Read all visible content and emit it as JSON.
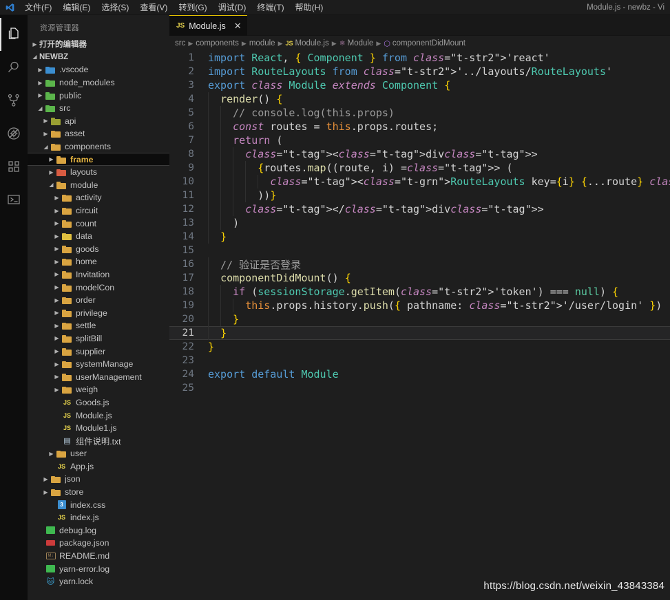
{
  "window": {
    "title": "Module.js - newbz - Vi",
    "logo_icon": "vscode-logo-icon"
  },
  "menubar": {
    "items": [
      {
        "label": "文件(F)",
        "name": "menu-file"
      },
      {
        "label": "编辑(E)",
        "name": "menu-edit"
      },
      {
        "label": "选择(S)",
        "name": "menu-selection"
      },
      {
        "label": "查看(V)",
        "name": "menu-view"
      },
      {
        "label": "转到(G)",
        "name": "menu-go"
      },
      {
        "label": "调试(D)",
        "name": "menu-debug"
      },
      {
        "label": "终端(T)",
        "name": "menu-terminal"
      },
      {
        "label": "帮助(H)",
        "name": "menu-help"
      }
    ]
  },
  "activitybar": {
    "items": [
      {
        "icon": "files-explorer-icon",
        "active": true
      },
      {
        "icon": "search-icon",
        "active": false
      },
      {
        "icon": "source-control-icon",
        "active": false
      },
      {
        "icon": "run-debug-disabled-icon",
        "active": false
      },
      {
        "icon": "extensions-icon",
        "active": false
      },
      {
        "icon": "terminal-icon",
        "active": false
      }
    ]
  },
  "sidebar": {
    "title": "资源管理器",
    "sections": [
      {
        "label": "打开的编辑器",
        "expanded": false
      },
      {
        "label": "NEWBZ",
        "expanded": true
      }
    ],
    "tree": [
      {
        "label": ".vscode",
        "depth": 1,
        "type": "folder",
        "color": "blue",
        "arrow": "collapsed"
      },
      {
        "label": "node_modules",
        "depth": 1,
        "type": "folder",
        "color": "green",
        "arrow": "collapsed"
      },
      {
        "label": "public",
        "depth": 1,
        "type": "folder",
        "color": "green",
        "arrow": "collapsed"
      },
      {
        "label": "src",
        "depth": 1,
        "type": "folder",
        "color": "green",
        "arrow": "expanded"
      },
      {
        "label": "api",
        "depth": 2,
        "type": "folder",
        "color": "olive",
        "arrow": "collapsed"
      },
      {
        "label": "asset",
        "depth": 2,
        "type": "folder",
        "color": "gold",
        "arrow": "collapsed"
      },
      {
        "label": "components",
        "depth": 2,
        "type": "folder",
        "color": "gold",
        "arrow": "expanded"
      },
      {
        "label": "frame",
        "depth": 3,
        "type": "folder",
        "color": "gold",
        "arrow": "collapsed",
        "selected": true
      },
      {
        "label": "layouts",
        "depth": 3,
        "type": "folder",
        "color": "red",
        "arrow": "collapsed"
      },
      {
        "label": "module",
        "depth": 3,
        "type": "folder",
        "color": "gold",
        "arrow": "expanded"
      },
      {
        "label": "activity",
        "depth": 4,
        "type": "folder",
        "color": "gold",
        "arrow": "collapsed"
      },
      {
        "label": "circuit",
        "depth": 4,
        "type": "folder",
        "color": "gold",
        "arrow": "collapsed"
      },
      {
        "label": "count",
        "depth": 4,
        "type": "folder",
        "color": "gold",
        "arrow": "collapsed"
      },
      {
        "label": "data",
        "depth": 4,
        "type": "folder",
        "color": "data",
        "arrow": "collapsed"
      },
      {
        "label": "goods",
        "depth": 4,
        "type": "folder",
        "color": "gold",
        "arrow": "collapsed"
      },
      {
        "label": "home",
        "depth": 4,
        "type": "folder",
        "color": "gold",
        "arrow": "collapsed"
      },
      {
        "label": "Invitation",
        "depth": 4,
        "type": "folder",
        "color": "gold",
        "arrow": "collapsed"
      },
      {
        "label": "modelCon",
        "depth": 4,
        "type": "folder",
        "color": "gold",
        "arrow": "collapsed"
      },
      {
        "label": "order",
        "depth": 4,
        "type": "folder",
        "color": "gold",
        "arrow": "collapsed"
      },
      {
        "label": "privilege",
        "depth": 4,
        "type": "folder",
        "color": "gold",
        "arrow": "collapsed"
      },
      {
        "label": "settle",
        "depth": 4,
        "type": "folder",
        "color": "gold",
        "arrow": "collapsed"
      },
      {
        "label": "splitBill",
        "depth": 4,
        "type": "folder",
        "color": "gold",
        "arrow": "collapsed"
      },
      {
        "label": "supplier",
        "depth": 4,
        "type": "folder",
        "color": "gold",
        "arrow": "collapsed"
      },
      {
        "label": "systemManage",
        "depth": 4,
        "type": "folder",
        "color": "gold",
        "arrow": "collapsed"
      },
      {
        "label": "userManagement",
        "depth": 4,
        "type": "folder",
        "color": "gold",
        "arrow": "collapsed"
      },
      {
        "label": "weigh",
        "depth": 4,
        "type": "folder",
        "color": "gold",
        "arrow": "collapsed"
      },
      {
        "label": "Goods.js",
        "depth": 4,
        "type": "js",
        "arrow": "none"
      },
      {
        "label": "Module.js",
        "depth": 4,
        "type": "js",
        "arrow": "none"
      },
      {
        "label": "Module1.js",
        "depth": 4,
        "type": "js",
        "arrow": "none"
      },
      {
        "label": "组件说明.txt",
        "depth": 4,
        "type": "txt",
        "arrow": "none"
      },
      {
        "label": "user",
        "depth": 3,
        "type": "folder",
        "color": "gold",
        "arrow": "collapsed"
      },
      {
        "label": "App.js",
        "depth": 3,
        "type": "js",
        "arrow": "none"
      },
      {
        "label": "json",
        "depth": 2,
        "type": "folder",
        "color": "gold",
        "arrow": "collapsed"
      },
      {
        "label": "store",
        "depth": 2,
        "type": "folder",
        "color": "gold",
        "arrow": "collapsed"
      },
      {
        "label": "index.css",
        "depth": 3,
        "type": "css",
        "arrow": "none"
      },
      {
        "label": "index.js",
        "depth": 3,
        "type": "js",
        "arrow": "none"
      },
      {
        "label": "debug.log",
        "depth": 1,
        "type": "log",
        "arrow": "none"
      },
      {
        "label": "package.json",
        "depth": 1,
        "type": "json",
        "arrow": "none"
      },
      {
        "label": "README.md",
        "depth": 1,
        "type": "md",
        "arrow": "none"
      },
      {
        "label": "yarn-error.log",
        "depth": 1,
        "type": "log",
        "arrow": "none"
      },
      {
        "label": "yarn.lock",
        "depth": 1,
        "type": "yarn",
        "arrow": "none"
      }
    ]
  },
  "editor": {
    "tabs": [
      {
        "label": "Module.js",
        "icon": "js-file-icon",
        "close_label": "✕",
        "active": true
      }
    ],
    "breadcrumb": [
      {
        "label": "src",
        "icon": ""
      },
      {
        "label": "components",
        "icon": ""
      },
      {
        "label": "module",
        "icon": ""
      },
      {
        "label": "Module.js",
        "icon": "js-file-icon"
      },
      {
        "label": "Module",
        "icon": "class-symbol-icon"
      },
      {
        "label": "componentDidMount",
        "icon": "method-symbol-icon"
      }
    ],
    "active_line": 21,
    "lines": [
      {
        "n": 1,
        "text": "import React, { Component } from 'react'"
      },
      {
        "n": 2,
        "text": "import RouteLayouts from '../layouts/RouteLayouts'"
      },
      {
        "n": 3,
        "text": "export class Module extends Component {"
      },
      {
        "n": 4,
        "text": "  render() {"
      },
      {
        "n": 5,
        "text": "    // console.log(this.props)"
      },
      {
        "n": 6,
        "text": "    const routes = this.props.routes;"
      },
      {
        "n": 7,
        "text": "    return ("
      },
      {
        "n": 8,
        "text": "      <div>"
      },
      {
        "n": 9,
        "text": "        {routes.map((route, i) => ("
      },
      {
        "n": 10,
        "text": "          <RouteLayouts key={i} {...route} />"
      },
      {
        "n": 11,
        "text": "        ))}"
      },
      {
        "n": 12,
        "text": "      </div>"
      },
      {
        "n": 13,
        "text": "    )"
      },
      {
        "n": 14,
        "text": "  }"
      },
      {
        "n": 15,
        "text": ""
      },
      {
        "n": 16,
        "text": "  // 验证是否登录"
      },
      {
        "n": 17,
        "text": "  componentDidMount() {"
      },
      {
        "n": 18,
        "text": "    if (sessionStorage.getItem('token') === null) {"
      },
      {
        "n": 19,
        "text": "      this.props.history.push({ pathname: '/user/login' })"
      },
      {
        "n": 20,
        "text": "    }"
      },
      {
        "n": 21,
        "text": "  }"
      },
      {
        "n": 22,
        "text": "}"
      },
      {
        "n": 23,
        "text": ""
      },
      {
        "n": 24,
        "text": "export default Module"
      },
      {
        "n": 25,
        "text": ""
      }
    ]
  },
  "watermark": {
    "text": "https://blog.csdn.net/weixin_43843384"
  },
  "colors": {
    "accent": "#e3c000",
    "editor_bg": "#1e1e1e",
    "sidebar_bg": "#1e1e1e",
    "activitybar_bg": "#0d0d0d",
    "titlebar_bg": "#1c1c1c",
    "selected_fg": "#e3b341"
  }
}
